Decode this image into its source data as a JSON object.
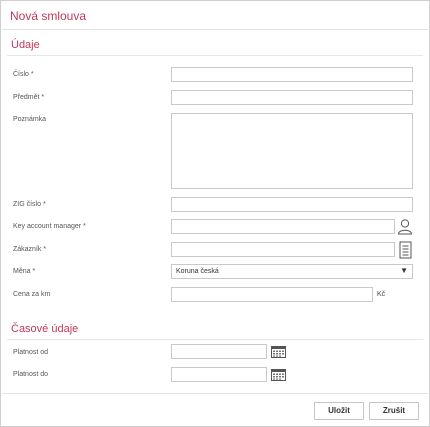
{
  "dialog": {
    "title": "Nová smlouva"
  },
  "sections": {
    "main": "Údaje",
    "time": "Časové údaje"
  },
  "fields": {
    "cislo": {
      "label": "Číslo *",
      "value": ""
    },
    "predmet": {
      "label": "Předmět *",
      "value": ""
    },
    "poznamka": {
      "label": "Poznámka",
      "value": ""
    },
    "zig": {
      "label": "ZIG číslo *",
      "value": ""
    },
    "kam": {
      "label": "Key account manager *",
      "value": ""
    },
    "zakaznik": {
      "label": "Zákazník *",
      "value": ""
    },
    "mena": {
      "label": "Měna *",
      "selected": "Koruna česká"
    },
    "cena": {
      "label": "Cena za km",
      "value": "",
      "unit": "Kč"
    },
    "platnost_od": {
      "label": "Platnost od",
      "value": ""
    },
    "platnost_do": {
      "label": "Platnost do",
      "value": ""
    }
  },
  "icons": {
    "kam": "user-icon",
    "zakaznik": "list-icon",
    "platnost_od": "calendar-icon",
    "platnost_do": "calendar-icon",
    "mena_arrow": "dropdown-arrow-icon"
  },
  "buttons": {
    "save": "Uložit",
    "cancel": "Zrušit"
  },
  "colors": {
    "accent": "#c0395a",
    "border": "#c9c9c9"
  }
}
